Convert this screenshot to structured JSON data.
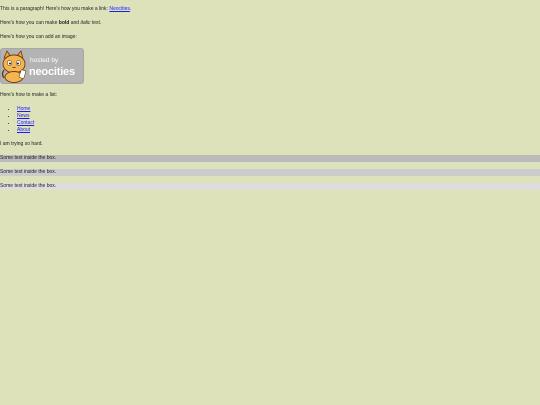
{
  "paragraph1": {
    "text_before": "This is a paragraph! Here's how you make a link: ",
    "link_text": "Neocities",
    "text_after": "."
  },
  "paragraph2": {
    "text_before": "Here's how you can make ",
    "bold": "bold",
    "text_middle": " and ",
    "italic": "italic",
    "text_after": " text."
  },
  "paragraph3": {
    "text": "Here's how you can add an image:"
  },
  "badge": {
    "line1": "hosted by",
    "line2": "neocities"
  },
  "paragraph4": {
    "text": "Here's how to make a list:"
  },
  "list": {
    "items": [
      "Home",
      "News",
      "Contact",
      "About"
    ]
  },
  "paragraph5": {
    "text": "I am trying so hard."
  },
  "boxes": [
    "Some text inside the box.",
    "Some text inside the box.",
    "Some text inside the box."
  ]
}
